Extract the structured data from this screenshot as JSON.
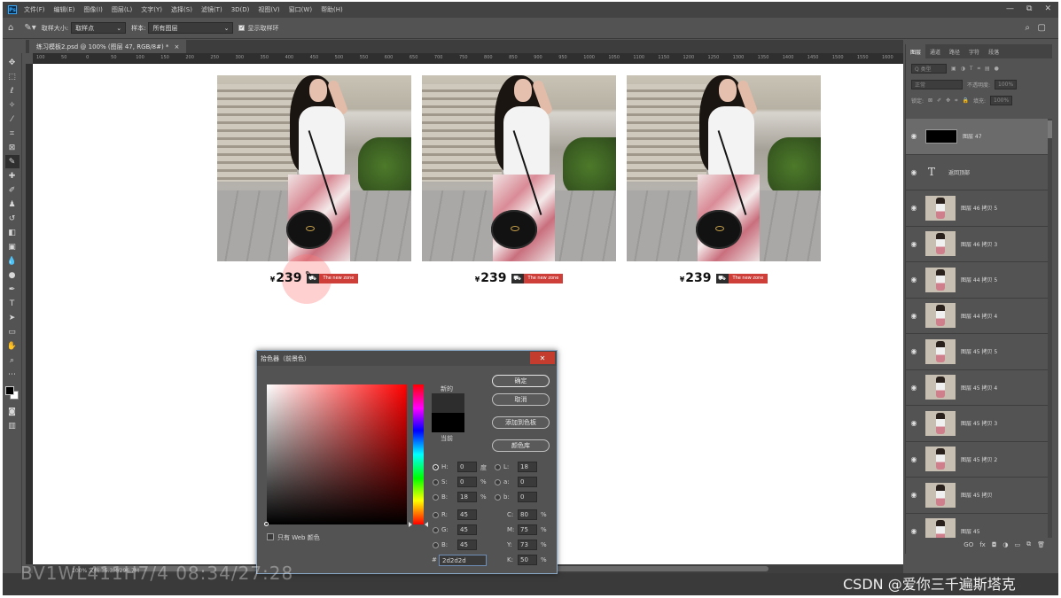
{
  "menubar": {
    "logo": "Ps",
    "items": [
      "文件(F)",
      "编辑(E)",
      "图像(I)",
      "图层(L)",
      "文字(Y)",
      "选择(S)",
      "滤镜(T)",
      "3D(D)",
      "视图(V)",
      "窗口(W)",
      "帮助(H)"
    ],
    "window_controls": [
      "—",
      "⧉",
      "✕"
    ]
  },
  "optionsbar": {
    "sample_size_label": "取样大小:",
    "sample_size_value": "取样点",
    "sample_label": "样本:",
    "sample_value": "所有图层",
    "show_ring_label": "显示取样环"
  },
  "document_tab": {
    "title": "练习模板2.psd @ 100% (图层 47, RGB/8#) *",
    "close": "×"
  },
  "ruler_ticks": [
    "100",
    "50",
    "0",
    "50",
    "100",
    "150",
    "200",
    "250",
    "300",
    "350",
    "400",
    "450",
    "500",
    "550",
    "600",
    "650",
    "700",
    "750",
    "800",
    "850",
    "900",
    "950",
    "1000",
    "1050",
    "1100",
    "1150",
    "1200",
    "1250",
    "1300",
    "1350",
    "1400",
    "1450",
    "1500",
    "1550",
    "1600"
  ],
  "products": [
    {
      "currency": "¥",
      "price": "239",
      "badge": "The new zone"
    },
    {
      "currency": "¥",
      "price": "239",
      "badge": "The new zone"
    },
    {
      "currency": "¥",
      "price": "239",
      "badge": "The new zone"
    }
  ],
  "status_text": "100%   文档:35.3M/296.7M",
  "layers_panel": {
    "tabs": [
      "图层",
      "通道",
      "路径",
      "字符",
      "段落"
    ],
    "filter_label": "Q 类型",
    "blend_mode": "正常",
    "opacity_label": "不透明度:",
    "opacity_value": "100%",
    "lock_label": "锁定:",
    "fill_label": "填充:",
    "fill_value": "100%",
    "layers": [
      {
        "name": "图层 47",
        "type": "black"
      },
      {
        "name": "返回顶部",
        "type": "text"
      },
      {
        "name": "图层 46 拷贝 5",
        "type": "photo"
      },
      {
        "name": "图层 46 拷贝 3",
        "type": "photo"
      },
      {
        "name": "图层 44 拷贝 5",
        "type": "photo"
      },
      {
        "name": "图层 44 拷贝 4",
        "type": "photo"
      },
      {
        "name": "图层 45 拷贝 5",
        "type": "photo"
      },
      {
        "name": "图层 45 拷贝 4",
        "type": "photo"
      },
      {
        "name": "图层 45 拷贝 3",
        "type": "photo"
      },
      {
        "name": "图层 45 拷贝 2",
        "type": "photo"
      },
      {
        "name": "图层 45 拷贝",
        "type": "photo"
      },
      {
        "name": "图层 45",
        "type": "photo"
      }
    ],
    "bottom_icons": [
      "GO",
      "fx",
      "◘",
      "◑",
      "▭",
      "⧉",
      "🗑"
    ]
  },
  "color_picker": {
    "title": "拾色器（前景色）",
    "close": "✕",
    "new_label": "新的",
    "current_label": "当前",
    "new_color": "#2d2d2d",
    "current_color": "#000000",
    "ok": "确定",
    "cancel": "取消",
    "add_swatch": "添加到色板",
    "color_library": "颜色库",
    "web_only": "只有 Web 颜色",
    "fields": {
      "H": "0",
      "H_unit": "度",
      "S": "0",
      "S_unit": "%",
      "B": "18",
      "B_unit": "%",
      "R": "45",
      "G": "45",
      "Bv": "45",
      "L": "18",
      "a": "0",
      "b": "0",
      "C": "80",
      "M": "75",
      "Y": "73",
      "K": "50"
    },
    "hex": "2d2d2d"
  },
  "watermark": "BV1WL411H7/4 08:34/27:28",
  "csdn_credit": "CSDN @爱你三千遍斯塔克"
}
